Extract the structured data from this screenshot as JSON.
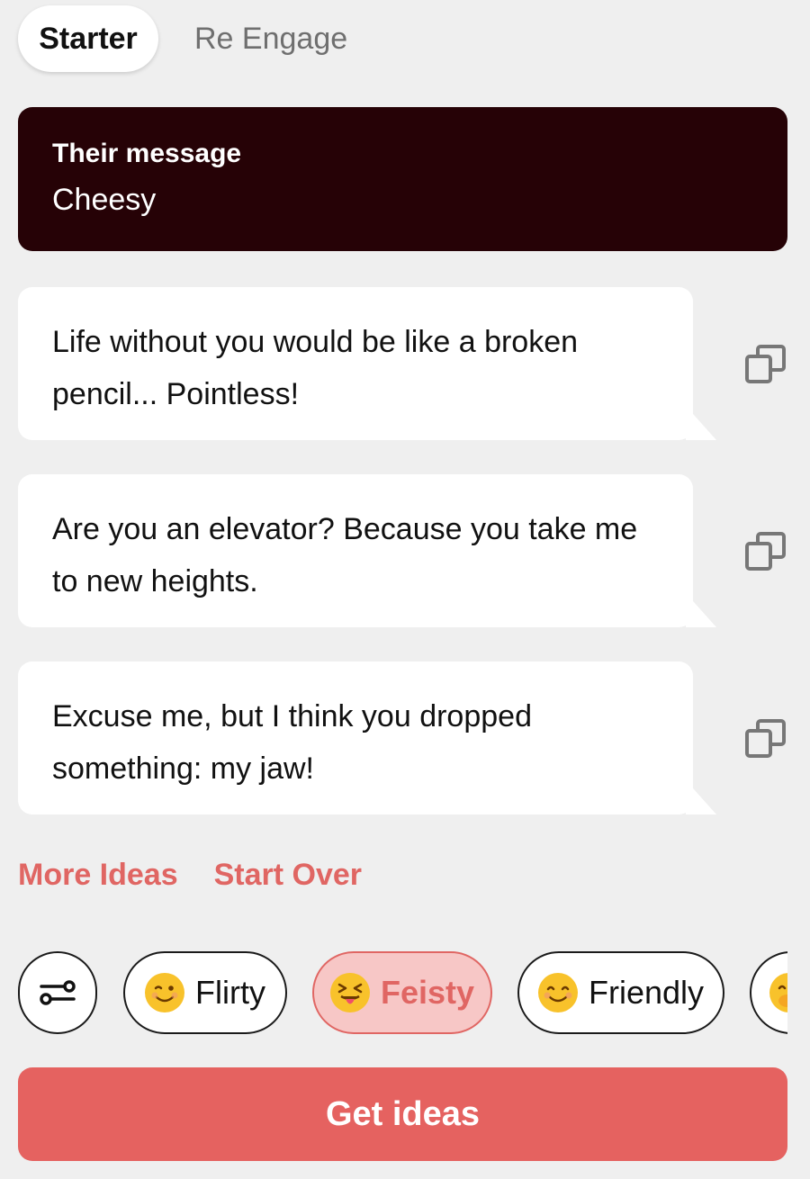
{
  "tabs": [
    {
      "label": "Starter",
      "active": true
    },
    {
      "label": "Re Engage",
      "active": false
    }
  ],
  "their_message": {
    "label": "Their message",
    "value": "Cheesy"
  },
  "suggestions": [
    {
      "text": "Life without you would be like a broken pencil... Pointless!",
      "icon": "copy-icon"
    },
    {
      "text": "Are you an elevator? Because you take me to new heights.",
      "icon": "copy-icon"
    },
    {
      "text": "Excuse me, but I think you dropped something: my jaw!",
      "icon": "copy-icon"
    }
  ],
  "actions": {
    "more_ideas": "More Ideas",
    "start_over": "Start Over"
  },
  "tones": [
    {
      "label": "",
      "icon": "sliders-icon",
      "selected": false
    },
    {
      "label": "Flirty",
      "emoji": "😉",
      "selected": false
    },
    {
      "label": "Feisty",
      "emoji": "😝",
      "selected": true
    },
    {
      "label": "Friendly",
      "emoji": "😊",
      "selected": false
    },
    {
      "label": "",
      "emoji": "🤭",
      "selected": false
    }
  ],
  "get_ideas_label": "Get ideas",
  "colors": {
    "background": "#efefef",
    "dark_card": "#260206",
    "accent": "#e56260",
    "accent_text": "#e06663",
    "selected_chip_bg": "#f7c7c6"
  }
}
